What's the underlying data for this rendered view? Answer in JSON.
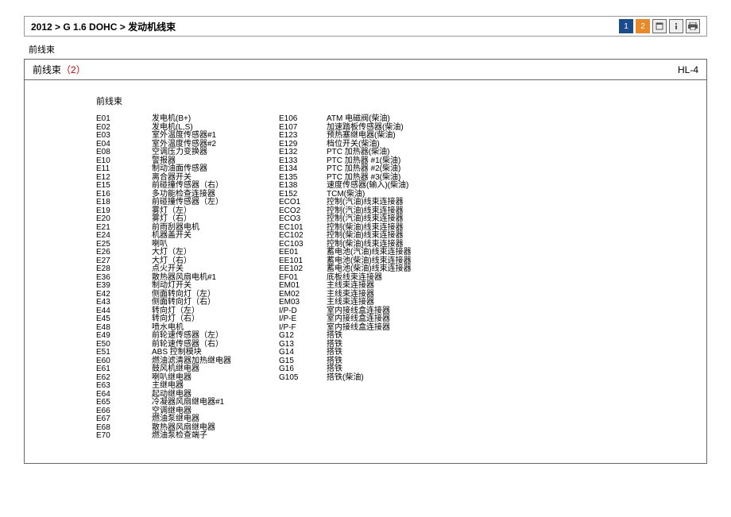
{
  "header": {
    "breadcrumb": "2012 > G 1.6 DOHC > 发动机线束",
    "page1": "1",
    "page2": "2"
  },
  "section_label": "前线束",
  "doc": {
    "title_text": "前线束",
    "title_num": "（2）",
    "code": "HL-4",
    "body_heading": "前线束"
  },
  "left": [
    {
      "c": "E01",
      "d": "发电机(B+)"
    },
    {
      "c": "E02",
      "d": "发电机(L,S)"
    },
    {
      "c": "E03",
      "d": "室外温度传感器#1"
    },
    {
      "c": "E04",
      "d": "室外温度传感器#2"
    },
    {
      "c": "E08",
      "d": "空调压力变换器"
    },
    {
      "c": "E10",
      "d": "警报器"
    },
    {
      "c": "E11",
      "d": "制动油面传感器"
    },
    {
      "c": "E12",
      "d": "离合器开关"
    },
    {
      "c": "E15",
      "d": "前碰撞传感器（右）"
    },
    {
      "c": "E16",
      "d": "多功能检查连接器"
    },
    {
      "c": "E18",
      "d": "前碰撞传感器（左）"
    },
    {
      "c": "E19",
      "d": "雾灯（左）"
    },
    {
      "c": "E20",
      "d": "雾灯（右）"
    },
    {
      "c": "E21",
      "d": "前雨刮器电机"
    },
    {
      "c": "E24",
      "d": "机器盖开关"
    },
    {
      "c": "E25",
      "d": "喇叭"
    },
    {
      "c": "E26",
      "d": "大灯（左）"
    },
    {
      "c": "E27",
      "d": "大灯（右）"
    },
    {
      "c": "E28",
      "d": "点火开关"
    },
    {
      "c": "E36",
      "d": "散热器风扇电机#1"
    },
    {
      "c": "E39",
      "d": "制动灯开关"
    },
    {
      "c": "E42",
      "d": "侧面转向灯（左）"
    },
    {
      "c": "E43",
      "d": "侧面转向灯（右）"
    },
    {
      "c": "E44",
      "d": "转向灯（左）"
    },
    {
      "c": "E45",
      "d": "转向灯（右）"
    },
    {
      "c": "E48",
      "d": "喷水电机"
    },
    {
      "c": "E49",
      "d": "前轮速传感器（左）"
    },
    {
      "c": "E50",
      "d": "前轮速传感器（右）"
    },
    {
      "c": "E51",
      "d": "ABS 控制模块"
    },
    {
      "c": "E60",
      "d": "燃油滤清器加热继电器"
    },
    {
      "c": "E61",
      "d": "鼓风机继电器"
    },
    {
      "c": "E62",
      "d": "喇叭继电器"
    },
    {
      "c": "E63",
      "d": "主继电器"
    },
    {
      "c": "E64",
      "d": "起动继电器"
    },
    {
      "c": "E65",
      "d": "冷凝器风扇继电器#1"
    },
    {
      "c": "E66",
      "d": "空调继电器"
    },
    {
      "c": "E67",
      "d": "燃油泵继电器"
    },
    {
      "c": "E68",
      "d": "散热器风扇继电器"
    },
    {
      "c": "E70",
      "d": "燃油泵检查端子"
    }
  ],
  "right": [
    {
      "c": "E106",
      "d": "ATM 电磁阀(柴油)"
    },
    {
      "c": "E107",
      "d": "加速踏板传感器(柴油)"
    },
    {
      "c": "E123",
      "d": "预热塞继电器(柴油)"
    },
    {
      "c": "E129",
      "d": "档位开关(柴油)"
    },
    {
      "c": "E132",
      "d": "PTC 加热器(柴油)"
    },
    {
      "c": "E133",
      "d": "PTC 加热器 #1(柴油)"
    },
    {
      "c": "E134",
      "d": "PTC 加热器 #2(柴油)"
    },
    {
      "c": "E135",
      "d": "PTC 加热器 #3(柴油)"
    },
    {
      "c": "E138",
      "d": "速度传感器(输入)(柴油)"
    },
    {
      "c": "E152",
      "d": "TCM(柴油)"
    },
    {
      "c": "ECO1",
      "d": "控制(汽油)线束连接器"
    },
    {
      "c": "ECO2",
      "d": "控制(汽油)线束连接器"
    },
    {
      "c": "ECO3",
      "d": "控制(汽油)线束连接器"
    },
    {
      "c": "EC101",
      "d": "控制(柴油)线束连接器"
    },
    {
      "c": "EC102",
      "d": "控制(柴油)线束连接器"
    },
    {
      "c": "EC103",
      "d": "控制(柴油)线束连接器"
    },
    {
      "c": "EE01",
      "d": "蓄电池(汽油)线束连接器"
    },
    {
      "c": "EE101",
      "d": "蓄电池(柴油)线束连接器"
    },
    {
      "c": "EE102",
      "d": "蓄电池(柴油)线束连接器"
    },
    {
      "c": "EF01",
      "d": "底板线束连接器"
    },
    {
      "c": "EM01",
      "d": "主线束连接器"
    },
    {
      "c": "EM02",
      "d": "主线束连接器"
    },
    {
      "c": "EM03",
      "d": "主线束连接器"
    },
    {
      "c": "I/P-D",
      "d": "室内接线盒连接器"
    },
    {
      "c": "I/P-E",
      "d": "室内接线盒连接器"
    },
    {
      "c": "I/P-F",
      "d": "室内接线盒连接器"
    },
    {
      "c": "G12",
      "d": "搭铁"
    },
    {
      "c": "G13",
      "d": "搭铁"
    },
    {
      "c": "G14",
      "d": "搭铁"
    },
    {
      "c": "G15",
      "d": "搭铁"
    },
    {
      "c": "G16",
      "d": "搭铁"
    },
    {
      "c": "G105",
      "d": "搭铁(柴油)"
    }
  ]
}
